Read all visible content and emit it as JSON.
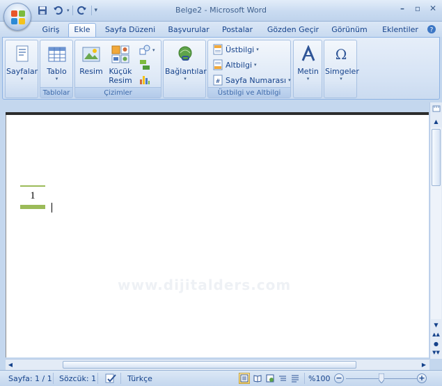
{
  "window": {
    "title": "Belge2 - Microsoft Word",
    "controls": {
      "minimize": "–",
      "restore": "▫",
      "close": "✕"
    }
  },
  "quick_access": {
    "save_icon": "save-icon",
    "undo_icon": "undo-icon",
    "redo_icon": "redo-icon",
    "customize": "▾"
  },
  "tabs": [
    {
      "label": "Giriş"
    },
    {
      "label": "Ekle"
    },
    {
      "label": "Sayfa Düzeni"
    },
    {
      "label": "Başvurular"
    },
    {
      "label": "Postalar"
    },
    {
      "label": "Gözden Geçir"
    },
    {
      "label": "Görünüm"
    },
    {
      "label": "Eklentiler"
    }
  ],
  "active_tab": "Ekle",
  "ribbon": {
    "groups": {
      "tablolar": "Tablolar",
      "cizimler": "Çizimler",
      "ustbilgi": "Üstbilgi ve Altbilgi"
    },
    "buttons": {
      "sayfalar": "Sayfalar",
      "tablo": "Tablo",
      "resim": "Resim",
      "kucuk_resim_1": "Küçük",
      "kucuk_resim_2": "Resim",
      "baglantilar": "Bağlantılar",
      "ustbilgi": "Üstbilgi",
      "altbilgi": "Altbilgi",
      "sayfa_numarasi": "Sayfa Numarası",
      "metin": "Metin",
      "simgeler": "Simgeler",
      "dropdown_glyph": "▾",
      "omega_glyph": "Ω"
    }
  },
  "document": {
    "page_number": "1",
    "watermark": "www.dijitalders.com"
  },
  "status_bar": {
    "page": "Sayfa: 1 / 1",
    "words": "Sözcük: 1",
    "language": "Türkçe",
    "zoom": "%100",
    "zoom_fraction": 0.5
  },
  "colors": {
    "accent": "#15428b",
    "page_number_bar": "#9bbb59",
    "ribbon_bg": "#dbe7f6"
  }
}
